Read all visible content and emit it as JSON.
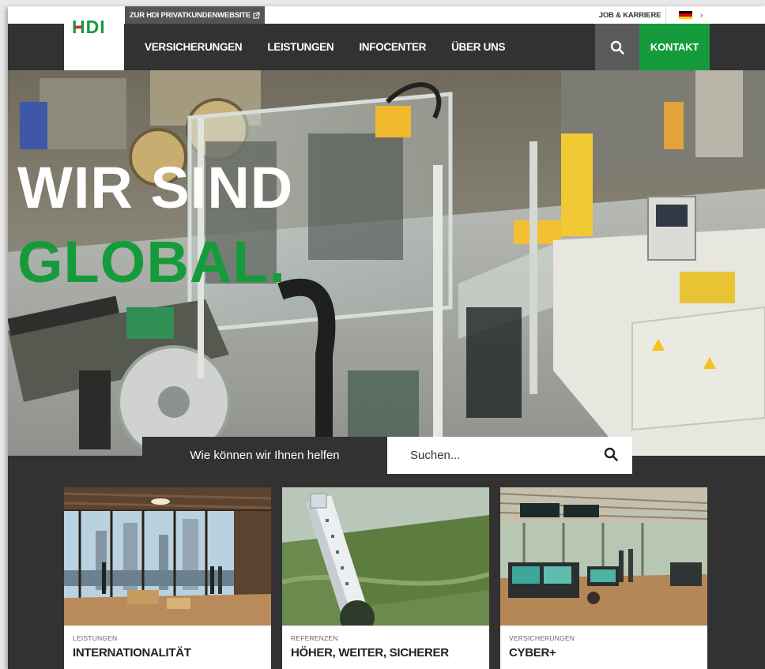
{
  "utility": {
    "privat_link": "ZUR HDI PRIVATKUNDENWEBSITE",
    "job": "JOB & KARRIERE",
    "lang_chevron": "›"
  },
  "logo": {
    "text": "HDI"
  },
  "nav": {
    "items": [
      "VERSICHERUNGEN",
      "LEISTUNGEN",
      "INFOCENTER",
      "ÜBER UNS"
    ],
    "contact": "KONTAKT"
  },
  "hero": {
    "line1": "WIR SIND",
    "line2": "GLOBAL."
  },
  "search": {
    "label": "Wie können wir Ihnen helfen",
    "placeholder": "Suchen..."
  },
  "cards": [
    {
      "category": "LEISTUNGEN",
      "title": "INTERNATIONALITÄT"
    },
    {
      "category": "REFERENZEN",
      "title": "HÖHER, WEITER, SICHERER"
    },
    {
      "category": "VERSICHERUNGEN",
      "title": "CYBER+"
    }
  ],
  "colors": {
    "brand_green": "#169b3c",
    "nav_dark": "#323232",
    "search_gray": "#5a5a5a",
    "hdi_red": "#d52b1e"
  },
  "icons": {
    "external": "external-link-icon",
    "search": "search-icon",
    "flag": "german-flag-icon",
    "chevron": "chevron-right-icon"
  }
}
